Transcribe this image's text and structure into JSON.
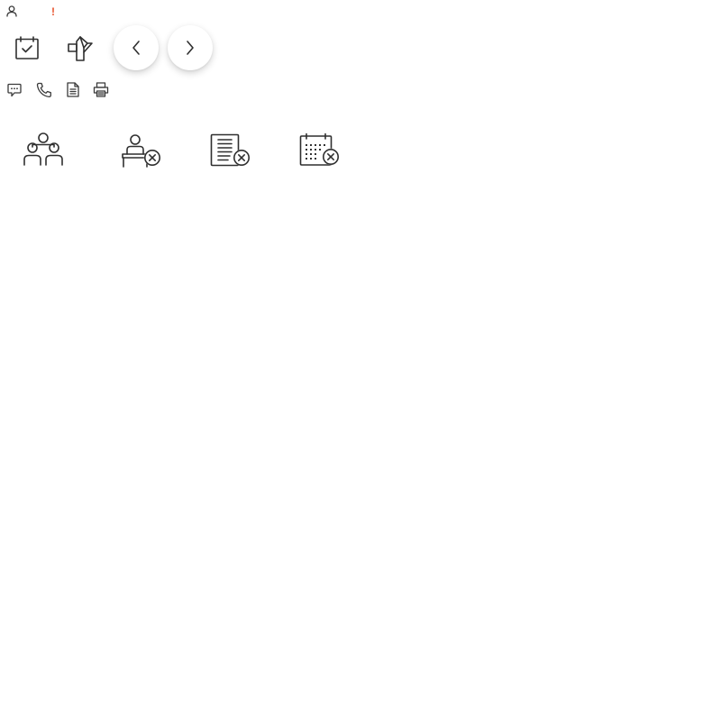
{
  "alert": {
    "text": "!",
    "color": "#e8542e"
  },
  "icons": {
    "row1": [
      "user-icon"
    ],
    "row2": [
      "calendar-check-icon",
      "direction-sign-icon",
      "chevron-left-icon",
      "chevron-right-icon"
    ],
    "row3": [
      "chat-icon",
      "phone-icon",
      "document-icon",
      "printer-icon"
    ],
    "row4": [
      "people-group-icon",
      "desk-person-cancel-icon",
      "document-cancel-icon",
      "calendar-cancel-icon"
    ]
  },
  "colors": {
    "icon_stroke": "#2f2f2f",
    "background": "#ffffff"
  }
}
